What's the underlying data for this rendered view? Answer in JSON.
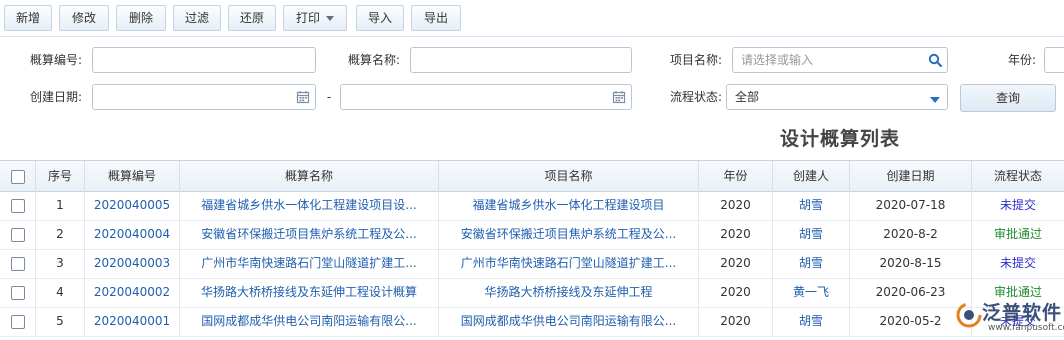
{
  "toolbar": {
    "add": "新增",
    "edit": "修改",
    "delete": "删除",
    "filter": "过滤",
    "restore": "还原",
    "print": "打印",
    "import": "导入",
    "export": "导出"
  },
  "filters": {
    "estimate_no_label": "概算编号:",
    "estimate_name_label": "概算名称:",
    "project_name_label": "项目名称:",
    "project_name_placeholder": "请选择或输入",
    "year_label": "年份:",
    "created_date_label": "创建日期:",
    "date_separator": "-",
    "status_label": "流程状态:",
    "status_value": "全部",
    "query_button": "查询"
  },
  "list_title": "设计概算列表",
  "table": {
    "headers": {
      "seq": "序号",
      "code": "概算编号",
      "name": "概算名称",
      "project": "项目名称",
      "year": "年份",
      "creator": "创建人",
      "date": "创建日期",
      "status": "流程状态"
    },
    "rows": [
      {
        "seq": "1",
        "code": "2020040005",
        "name": "福建省城乡供水一体化工程建设项目设...",
        "project": "福建省城乡供水一体化工程建设项目",
        "year": "2020",
        "creator": "胡雪",
        "date": "2020-07-18",
        "status": "未提交"
      },
      {
        "seq": "2",
        "code": "2020040004",
        "name": "安徽省环保搬迁项目焦炉系统工程及公...",
        "project": "安徽省环保搬迁项目焦炉系统工程及公...",
        "year": "2020",
        "creator": "胡雪",
        "date": "2020-8-2",
        "status": "审批通过"
      },
      {
        "seq": "3",
        "code": "2020040003",
        "name": "广州市华南快速路石门堂山隧道扩建工...",
        "project": "广州市华南快速路石门堂山隧道扩建工...",
        "year": "2020",
        "creator": "胡雪",
        "date": "2020-8-15",
        "status": "未提交"
      },
      {
        "seq": "4",
        "code": "2020040002",
        "name": "华扬路大桥桥接线及东延伸工程设计概算",
        "project": "华扬路大桥桥接线及东延伸工程",
        "year": "2020",
        "creator": "黄一飞",
        "date": "2020-06-23",
        "status": "审批通过"
      },
      {
        "seq": "5",
        "code": "2020040001",
        "name": "国网成都成华供电公司南阳运输有限公...",
        "project": "国网成都成华供电公司南阳运输有限公...",
        "year": "2020",
        "creator": "胡雪",
        "date": "2020-05-2",
        "status": "未提交"
      }
    ]
  },
  "watermark": {
    "brand": "泛普软件",
    "url": "www.fanpusoft.com"
  },
  "colors": {
    "link": "#1f5fb0",
    "status_pending": "#2b2fc9",
    "status_approved": "#1e8a2e"
  }
}
